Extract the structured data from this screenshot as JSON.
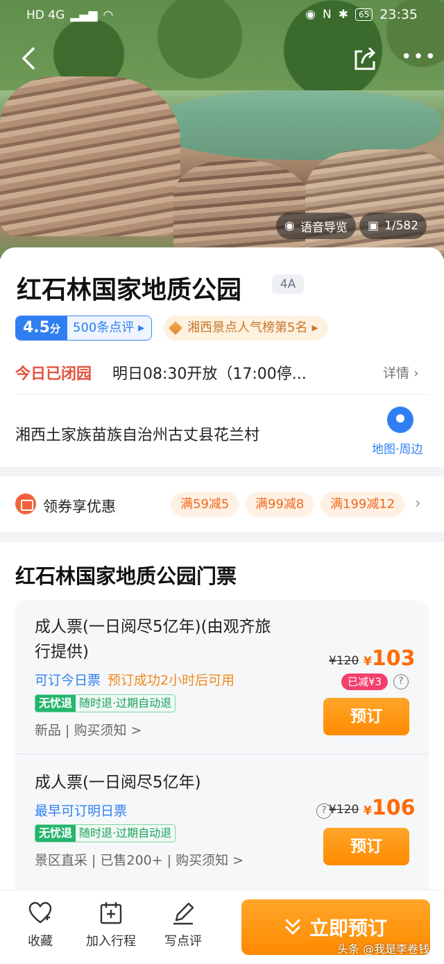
{
  "status_bar": {
    "network": "HD 4G",
    "battery": "65",
    "time": "23:35"
  },
  "hero": {
    "audio_guide": "语音导览",
    "photo_count": "1/582"
  },
  "scenic": {
    "title": "红石林国家地质公园",
    "level": "4A",
    "score": "4.5",
    "score_unit": "分",
    "review_count": "500条点评",
    "rank": "湘西景点人气榜第5名",
    "closed_status": "今日已闭园",
    "open_info": "明日08:30开放（17:00停...",
    "details": "详情",
    "address": "湘西土家族苗族自治州古丈县花兰村",
    "map_label": "地图·周边"
  },
  "coupon": {
    "label": "领券享优惠",
    "chips": [
      "满59减5",
      "满99减8",
      "满199减12"
    ]
  },
  "tickets": {
    "title": "红石林国家地质公园门票",
    "items": [
      {
        "name_line1": "成人票(一日阅尽5亿年)(由观齐旅",
        "name_line2": "行提供)",
        "availability": "可订今日票",
        "availability_note": "预订成功2小时后可用",
        "tag_a": "无忧退",
        "tag_b": "随时退·过期自动退",
        "meta": "新品 | 购买须知 >",
        "orig_price": "¥120",
        "currency": "¥",
        "price": "103",
        "discount": "已减¥3",
        "book": "预订"
      },
      {
        "name_line1": "成人票(一日阅尽5亿年)",
        "availability": "最早可订明日票",
        "tag_a": "无忧退",
        "tag_b": "随时退·过期自动退",
        "meta": "景区直采 | 已售200+ | 购买须知 >",
        "orig_price": "¥120",
        "currency": "¥",
        "price": "106",
        "book": "预订"
      }
    ]
  },
  "bottom_bar": {
    "favorite": "收藏",
    "add_trip": "加入行程",
    "write_review": "写点评",
    "book_now": "立即预订"
  },
  "watermark": "头条 @我是李卷钱",
  "colors": {
    "accent_orange": "#ff8a00",
    "accent_blue": "#2f7ff2",
    "closed_red": "#e4513c"
  }
}
